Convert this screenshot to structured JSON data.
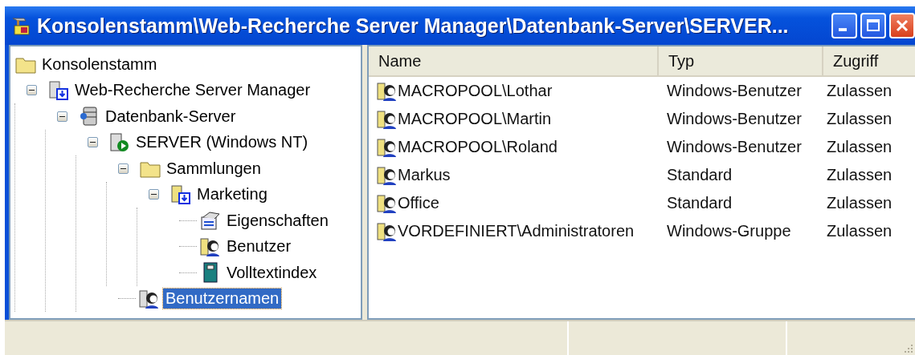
{
  "window": {
    "title": "Konsolenstamm\\Web-Recherche Server Manager\\Datenbank-Server\\SERVER..."
  },
  "tree": [
    {
      "label": "Konsolenstamm",
      "kind": "folder",
      "selected": false,
      "children": [
        {
          "label": "Web-Recherche Server Manager",
          "kind": "manager",
          "selected": false,
          "expanded": true,
          "children": [
            {
              "label": "Datenbank-Server",
              "kind": "database",
              "selected": false,
              "expanded": true,
              "children": [
                {
                  "label": "SERVER (Windows NT)",
                  "kind": "server",
                  "selected": false,
                  "expanded": true,
                  "children": [
                    {
                      "label": "Sammlungen",
                      "kind": "folder",
                      "selected": false,
                      "expanded": true,
                      "children": [
                        {
                          "label": "Marketing",
                          "kind": "collection",
                          "selected": false,
                          "expanded": true,
                          "children": [
                            {
                              "label": "Eigenschaften",
                              "kind": "properties",
                              "selected": false
                            },
                            {
                              "label": "Benutzer",
                              "kind": "user",
                              "selected": false
                            },
                            {
                              "label": "Volltextindex",
                              "kind": "index",
                              "selected": false
                            }
                          ]
                        }
                      ]
                    },
                    {
                      "label": "Benutzernamen",
                      "kind": "usernames",
                      "selected": true
                    }
                  ]
                }
              ]
            }
          ]
        }
      ]
    }
  ],
  "table": {
    "columns": [
      "Name",
      "Typ",
      "Zugriff"
    ],
    "rows": [
      {
        "name": "MACROPOOL\\Lothar",
        "type": "Windows-Benutzer",
        "access": "Zulassen"
      },
      {
        "name": "MACROPOOL\\Martin",
        "type": "Windows-Benutzer",
        "access": "Zulassen"
      },
      {
        "name": "MACROPOOL\\Roland",
        "type": "Windows-Benutzer",
        "access": "Zulassen"
      },
      {
        "name": "Markus",
        "type": "Standard",
        "access": "Zulassen"
      },
      {
        "name": "Office",
        "type": "Standard",
        "access": "Zulassen"
      },
      {
        "name": "VORDEFINIERT\\Administratoren",
        "type": "Windows-Gruppe",
        "access": "Zulassen"
      }
    ]
  }
}
